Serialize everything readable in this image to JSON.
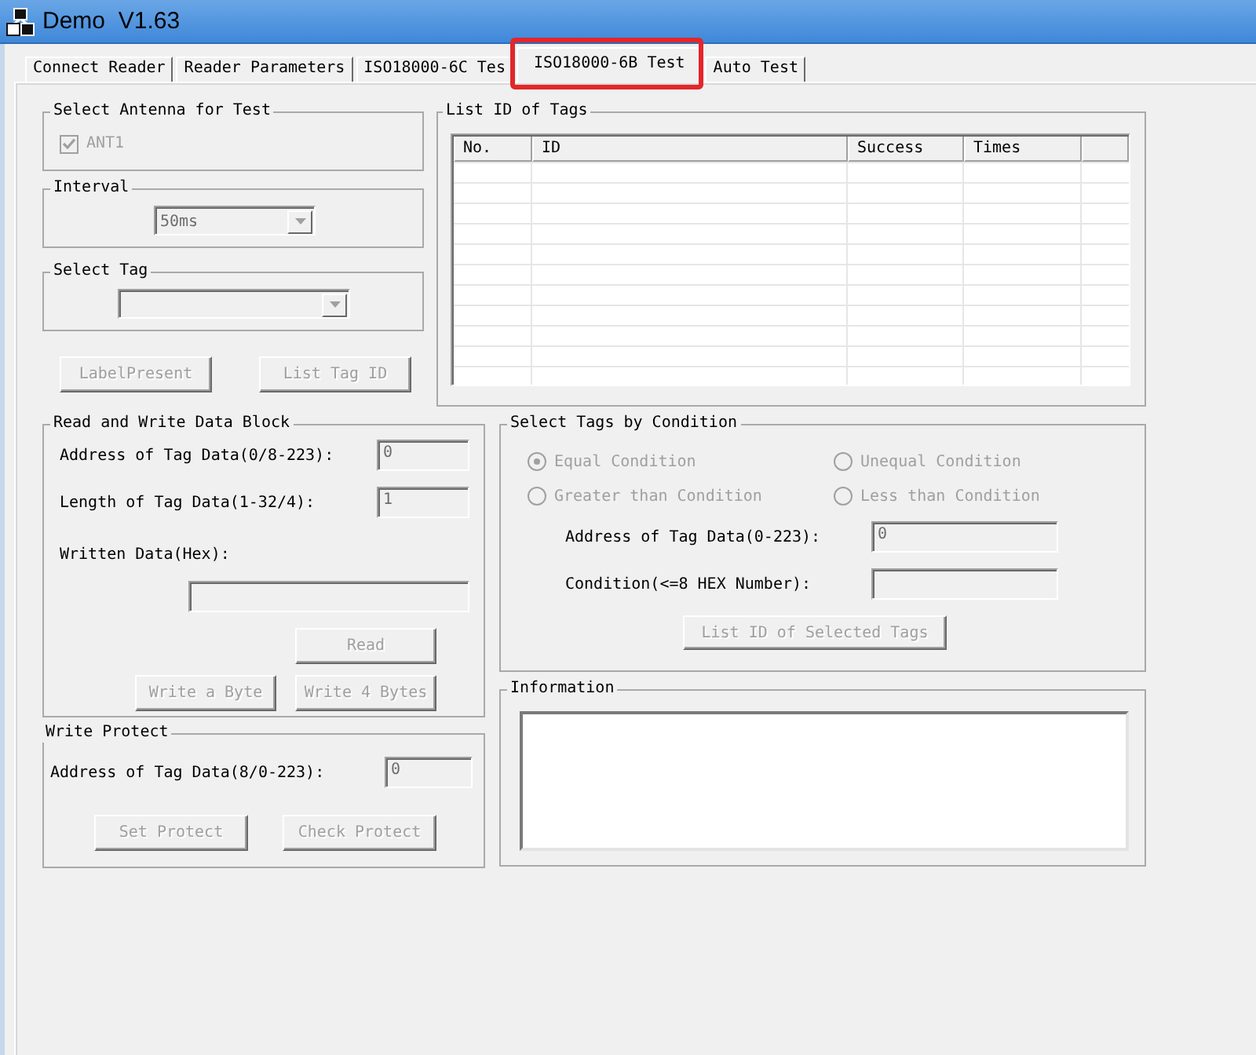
{
  "window": {
    "title": "Demo  V1.63"
  },
  "tabs": [
    {
      "label": "Connect Reader",
      "selected": false,
      "highlighted": false
    },
    {
      "label": "Reader Parameters",
      "selected": false,
      "highlighted": false
    },
    {
      "label": "ISO18000-6C Tes",
      "selected": false,
      "highlighted": false
    },
    {
      "label": "ISO18000-6B Test",
      "selected": true,
      "highlighted": true
    },
    {
      "label": "Auto Test",
      "selected": false,
      "highlighted": false
    }
  ],
  "antenna_group": {
    "title": "Select Antenna for Test",
    "checkbox": {
      "label": "ANT1",
      "checked": true,
      "disabled": true
    }
  },
  "interval_group": {
    "title": "Interval",
    "dropdown": {
      "value": "50ms",
      "disabled": true
    }
  },
  "select_tag_group": {
    "title": "Select Tag",
    "dropdown": {
      "disabled": true
    }
  },
  "tag_buttons": [
    {
      "label": "LabelPresent",
      "disabled": true
    },
    {
      "label": "List Tag ID",
      "disabled": true
    }
  ],
  "tag_list": {
    "title": "List ID of Tags",
    "columns": [
      "No.",
      "ID",
      "Success",
      "Times"
    ]
  },
  "read_write_group": {
    "title": "Read and Write Data Block",
    "fields": [
      {
        "label": "Address of Tag Data(0/8-223):",
        "value": "0",
        "disabled": true
      },
      {
        "label": "Length of Tag Data(1-32/4):",
        "value": "1",
        "disabled": true
      }
    ],
    "data_field": {
      "label": "Written Data(Hex):",
      "disabled": true
    },
    "read_button": {
      "label": "Read",
      "disabled": true
    },
    "write_buttons": [
      {
        "label": "Write a Byte",
        "disabled": true
      },
      {
        "label": "Write 4 Bytes",
        "disabled": true
      }
    ]
  },
  "write_protect_group": {
    "title": "Write Protect",
    "field": {
      "label": "Address of Tag Data(8/0-223):",
      "value": "0",
      "disabled": true
    },
    "buttons": [
      {
        "label": "Set Protect",
        "disabled": true
      },
      {
        "label": "Check Protect",
        "disabled": true
      }
    ]
  },
  "condition_group": {
    "title": "Select Tags by Condition",
    "options": [
      {
        "label": "Equal Condition",
        "selected": true,
        "disabled": true
      },
      {
        "label": "Unequal Condition",
        "selected": false,
        "disabled": true
      },
      {
        "label": "Greater than Condition",
        "selected": false,
        "disabled": true
      },
      {
        "label": "Less than Condition",
        "selected": false,
        "disabled": true
      }
    ],
    "fields": [
      {
        "label": "Address of Tag Data(0-223):",
        "value": "0",
        "disabled": true
      },
      {
        "label": "Condition(<=8 HEX Number):",
        "disabled": true
      }
    ],
    "button": {
      "label": "List ID of Selected Tags",
      "disabled": true
    }
  },
  "information_group": {
    "title": "Information"
  }
}
